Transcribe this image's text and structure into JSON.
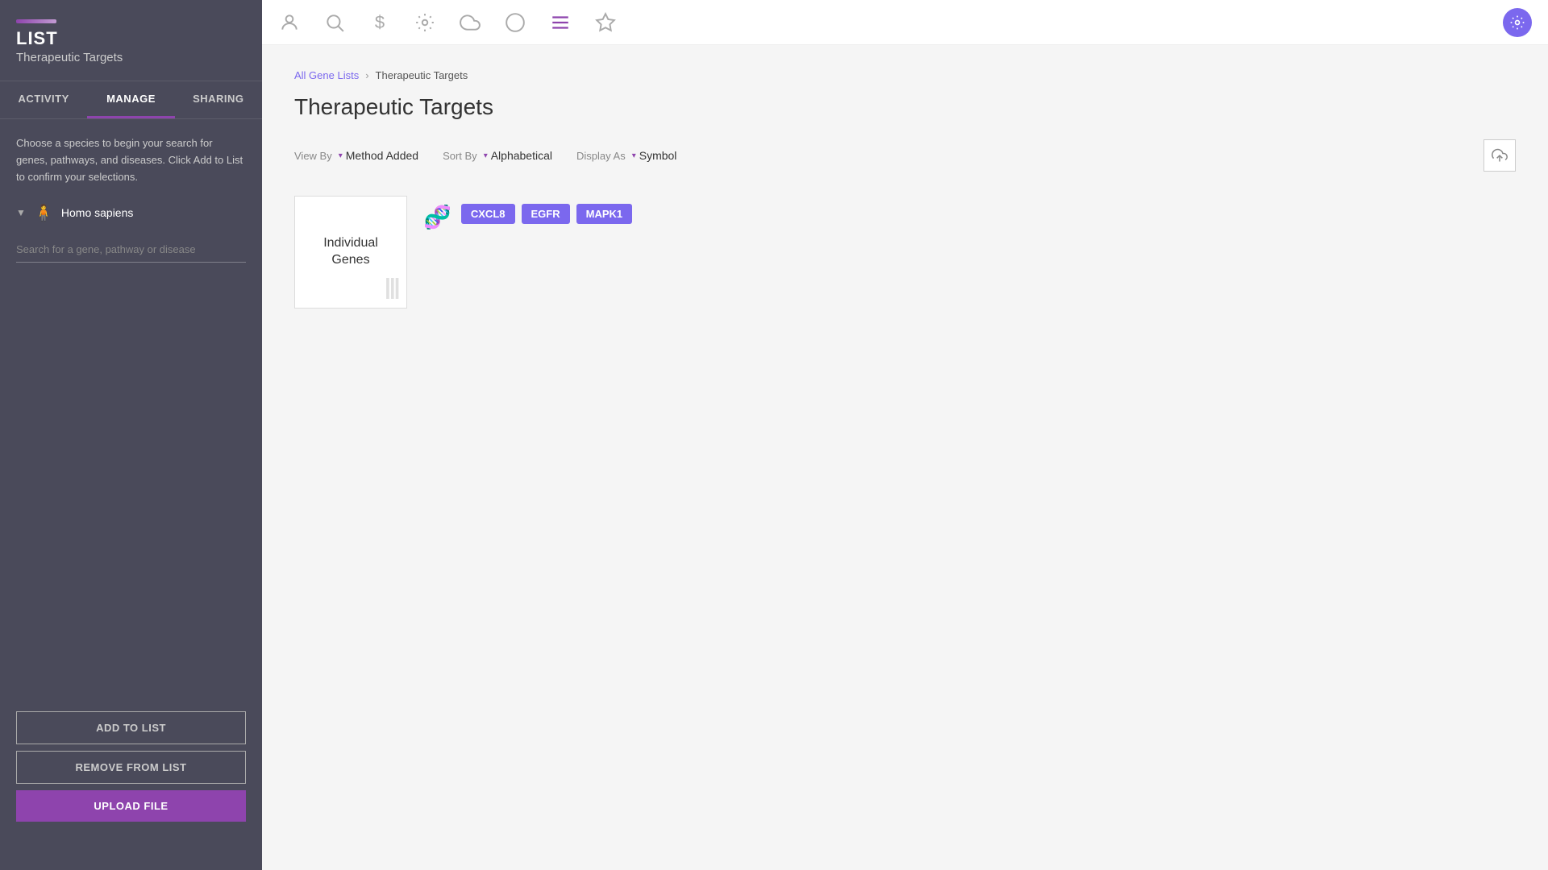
{
  "sidebar": {
    "accent": "#8e44ad",
    "list_label": "LIST",
    "list_sublabel": "Therapeutic Targets",
    "tabs": [
      {
        "id": "activity",
        "label": "ACTIVITY"
      },
      {
        "id": "manage",
        "label": "MANAGE",
        "active": true
      },
      {
        "id": "sharing",
        "label": "SHARING"
      }
    ],
    "description": "Choose a species to begin your search for genes, pathways, and diseases. Click Add to List to confirm your selections.",
    "species": {
      "name": "Homo sapiens"
    },
    "search_placeholder": "Search for a gene, pathway or disease",
    "buttons": {
      "add_to_list": "ADD TO LIST",
      "remove_from_list": "REMOVE FROM LIST",
      "upload_file": "UPLOAD FILE"
    }
  },
  "nav": {
    "icons": [
      {
        "name": "person-icon",
        "symbol": "👤",
        "active": false
      },
      {
        "name": "search-icon",
        "symbol": "🔍",
        "active": false
      },
      {
        "name": "dollar-icon",
        "symbol": "$",
        "active": false
      },
      {
        "name": "gear-icon",
        "symbol": "⚙",
        "active": false
      },
      {
        "name": "cloud-icon",
        "symbol": "☁",
        "active": false
      },
      {
        "name": "chart-icon",
        "symbol": "◑",
        "active": false
      },
      {
        "name": "list-icon",
        "symbol": "≡",
        "active": true
      },
      {
        "name": "star-icon",
        "symbol": "☆",
        "active": false
      }
    ],
    "settings_icon": "✦"
  },
  "breadcrumb": {
    "parent_label": "All Gene Lists",
    "separator": "›",
    "current": "Therapeutic Targets"
  },
  "page": {
    "title": "Therapeutic Targets",
    "view_by": {
      "label": "View By",
      "value": "Method Added"
    },
    "sort_by": {
      "label": "Sort By",
      "value": "Alphabetical"
    },
    "display_as": {
      "label": "Display As",
      "value": "Symbol"
    }
  },
  "gene_card": {
    "label_line1": "Individual",
    "label_line2": "Genes",
    "watermark": "DNA"
  },
  "genes": [
    {
      "symbol": "CXCL8"
    },
    {
      "symbol": "EGFR"
    },
    {
      "symbol": "MAPK1"
    }
  ]
}
